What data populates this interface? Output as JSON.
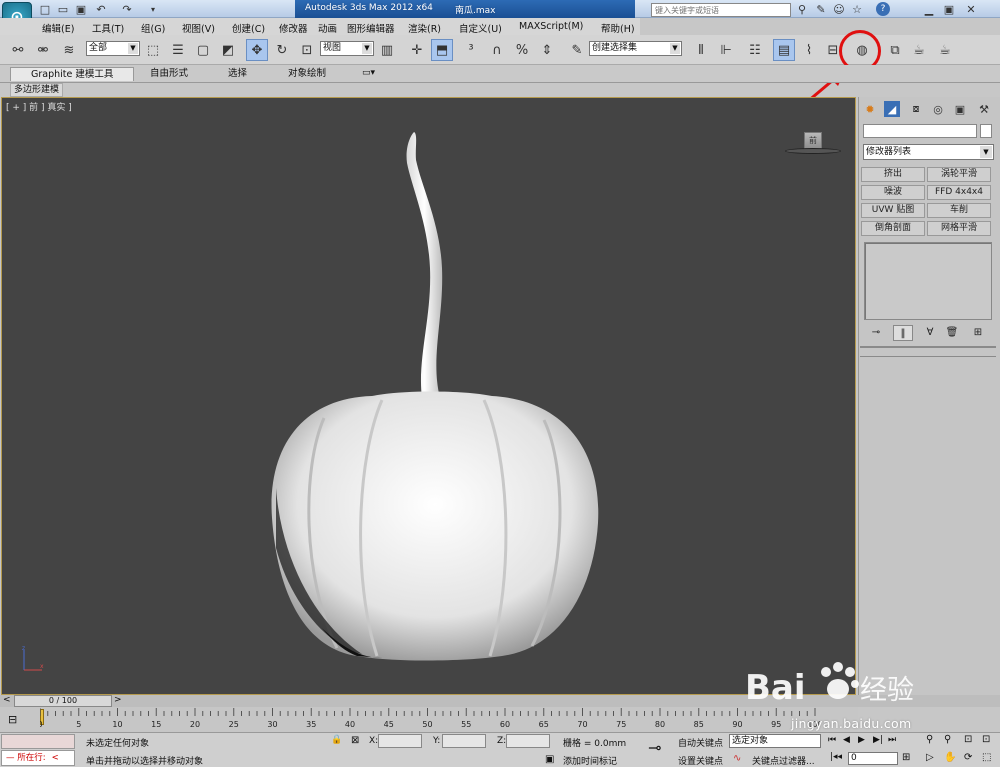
{
  "titlebar": {
    "app_title": "Autodesk 3ds Max  2012 x64",
    "file_name": "南瓜.max",
    "search_placeholder": "键入关键字或短语"
  },
  "menu": {
    "items": [
      "编辑(E)",
      "工具(T)",
      "组(G)",
      "视图(V)",
      "创建(C)",
      "修改器",
      "动画",
      "图形编辑器",
      "渲染(R)",
      "自定义(U)",
      "MAXScript(M)",
      "帮助(H)"
    ]
  },
  "toolbar": {
    "selection_filter": "全部",
    "ref_coord": "视图",
    "named_selection": "创建选择集"
  },
  "ribbon": {
    "tabs": [
      "Graphite 建模工具",
      "自由形式",
      "选择",
      "对象绘制"
    ],
    "sub_label": "多边形建模"
  },
  "viewport": {
    "label": "[ + ] 前 ] 真实 ]",
    "viewcube_label": "前"
  },
  "command_panel": {
    "modifier_list": "修改器列表",
    "modifier_buttons": [
      "挤出",
      "涡轮平滑",
      "噪波",
      "FFD 4x4x4",
      "UVW 贴图",
      "车削",
      "倒角剖面",
      "网格平滑"
    ]
  },
  "timeline": {
    "frame_range": "0 / 100",
    "ticks": [
      "0",
      "5",
      "10",
      "15",
      "20",
      "25",
      "30",
      "35",
      "40",
      "45",
      "50",
      "55",
      "60",
      "65",
      "70",
      "75",
      "80",
      "85",
      "90",
      "95",
      "100"
    ]
  },
  "status": {
    "executing": "所在行:",
    "message_top": "未选定任何对象",
    "message_bottom": "单击并拖动以选择并移动对象",
    "x_label": "X:",
    "y_label": "Y:",
    "z_label": "Z:",
    "grid": "栅格 = 0.0mm",
    "add_time_tag": "添加时间标记",
    "auto_key": "自动关键点",
    "set_key": "设置关键点",
    "selected_set": "选定对象",
    "key_filters": "关键点过滤器...",
    "frame": "0"
  },
  "watermark": {
    "brand": "Baidu 经验",
    "url": "jingyan.baidu.com"
  },
  "colors": {
    "viewport_bg": "#444444",
    "viewport_border": "#b59a4d",
    "callout": "#e01010",
    "title_bar": "#1a4f93"
  }
}
